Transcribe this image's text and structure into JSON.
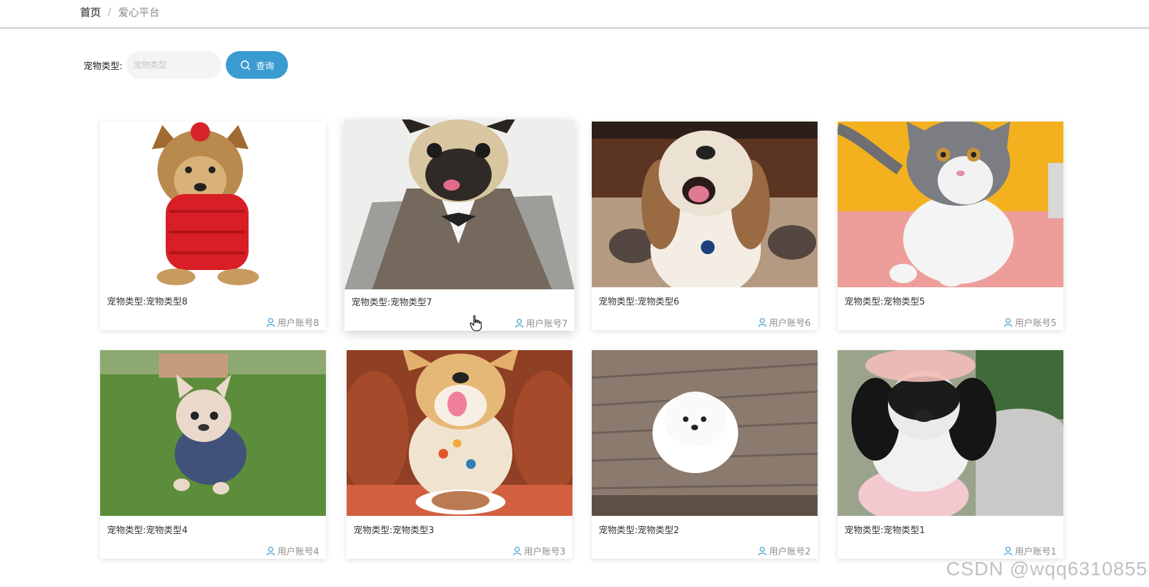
{
  "breadcrumb": {
    "home": "首页",
    "separator": "/",
    "current": "爱心平台"
  },
  "search": {
    "label": "宠物类型:",
    "placeholder": "宠物类型",
    "value": "",
    "button_label": "查询",
    "button_icon": "search-icon",
    "button_color": "#3a9bd0"
  },
  "cards": [
    {
      "pet_type": "宠物类型:宠物类型8",
      "owner": "用户账号8",
      "photo": "yorkshire-terrier-red-sweater"
    },
    {
      "pet_type": "宠物类型:宠物类型7",
      "owner": "用户账号7",
      "photo": "pug-in-tweed-suit"
    },
    {
      "pet_type": "宠物类型:宠物类型6",
      "owner": "用户账号6",
      "photo": "shih-tzu-on-carpet"
    },
    {
      "pet_type": "宠物类型:宠物类型5",
      "owner": "用户账号5",
      "photo": "grey-white-kitten"
    },
    {
      "pet_type": "宠物类型:宠物类型4",
      "owner": "用户账号4",
      "photo": "french-bulldog-puppy-on-grass"
    },
    {
      "pet_type": "宠物类型:宠物类型3",
      "owner": "用户账号3",
      "photo": "corgi-with-cake"
    },
    {
      "pet_type": "宠物类型:宠物类型2",
      "owner": "用户账号2",
      "photo": "white-pomeranian-on-wood"
    },
    {
      "pet_type": "宠物类型:宠物类型1",
      "owner": "用户账号1",
      "photo": "poodle-with-pink-bow"
    }
  ],
  "watermark": "CSDN @wqq6310855"
}
